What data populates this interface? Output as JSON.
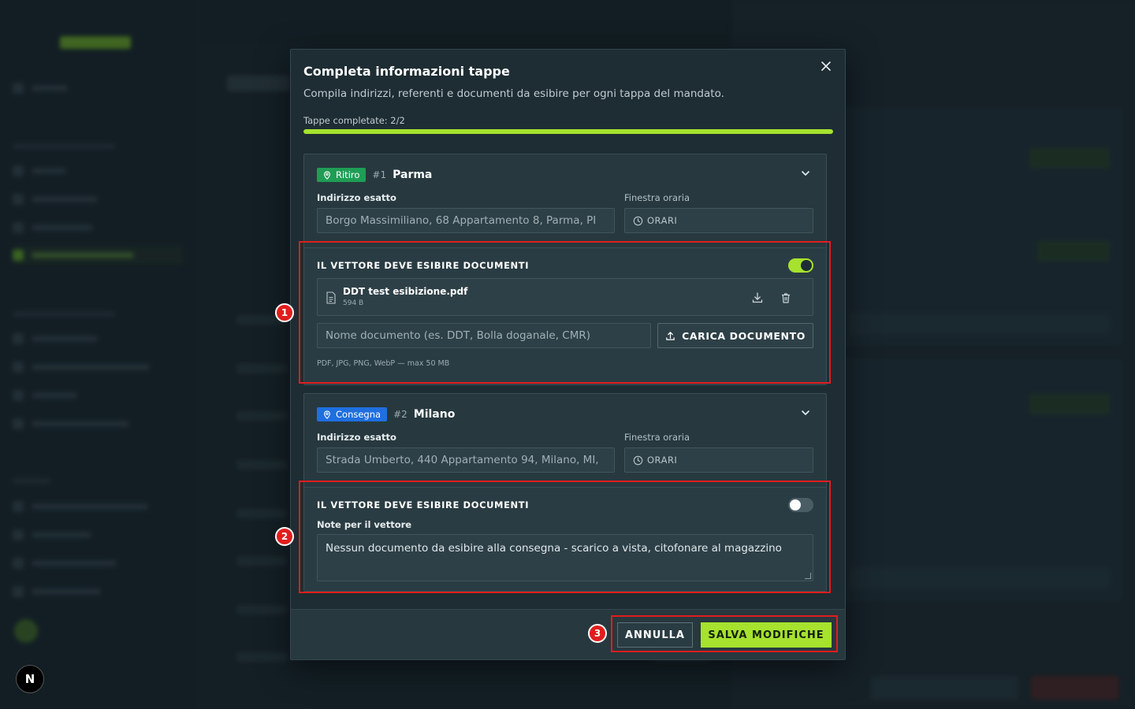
{
  "modal": {
    "title": "Completa informazioni tappe",
    "subtitle": "Compila indirizzi, referenti e documenti da esibire per ogni tappa del mandato.",
    "progress_label": "Tappe completate: 2/2",
    "progress_fraction": 1.0
  },
  "stops": [
    {
      "type_label": "Ritiro",
      "number": "#1",
      "city": "Parma",
      "address_label": "Indirizzo esatto",
      "address_value": "Borgo Massimiliano, 68 Appartamento 8, Parma, PI",
      "window_label": "Finestra oraria",
      "window_value": "ORARI",
      "docs_title": "IL VETTORE DEVE ESIBIRE DOCUMENTI",
      "docs_enabled": true,
      "file_name": "DDT test esibizione.pdf",
      "file_size": "594 B",
      "doc_name_placeholder": "Nome documento (es. DDT, Bolla doganale, CMR)",
      "upload_label": "CARICA DOCUMENTO",
      "formats_hint": "PDF, JPG, PNG, WebP — max 50 MB"
    },
    {
      "type_label": "Consegna",
      "number": "#2",
      "city": "Milano",
      "address_label": "Indirizzo esatto",
      "address_value": "Strada Umberto, 440 Appartamento 94, Milano, MI,",
      "window_label": "Finestra oraria",
      "window_value": "ORARI",
      "docs_title": "IL VETTORE DEVE ESIBIRE DOCUMENTI",
      "docs_enabled": false,
      "notes_label": "Note per il vettore",
      "notes_value": "Nessun documento da esibire alla consegna - scarico a vista, citofonare al magazzino"
    }
  ],
  "footer": {
    "cancel_label": "ANNULLA",
    "save_label": "SALVA MODIFICHE"
  },
  "annotations": [
    "1",
    "2",
    "3"
  ],
  "next_badge": "N",
  "colors": {
    "accent": "#a6e22e",
    "pickup_badge": "#1f9d55",
    "delivery_badge": "#1f6fe0",
    "annotation": "#e11d1d"
  },
  "icons": [
    "close-icon",
    "location-pin-icon",
    "chevron-down-icon",
    "clock-icon",
    "document-icon",
    "download-icon",
    "trash-icon",
    "upload-icon"
  ]
}
